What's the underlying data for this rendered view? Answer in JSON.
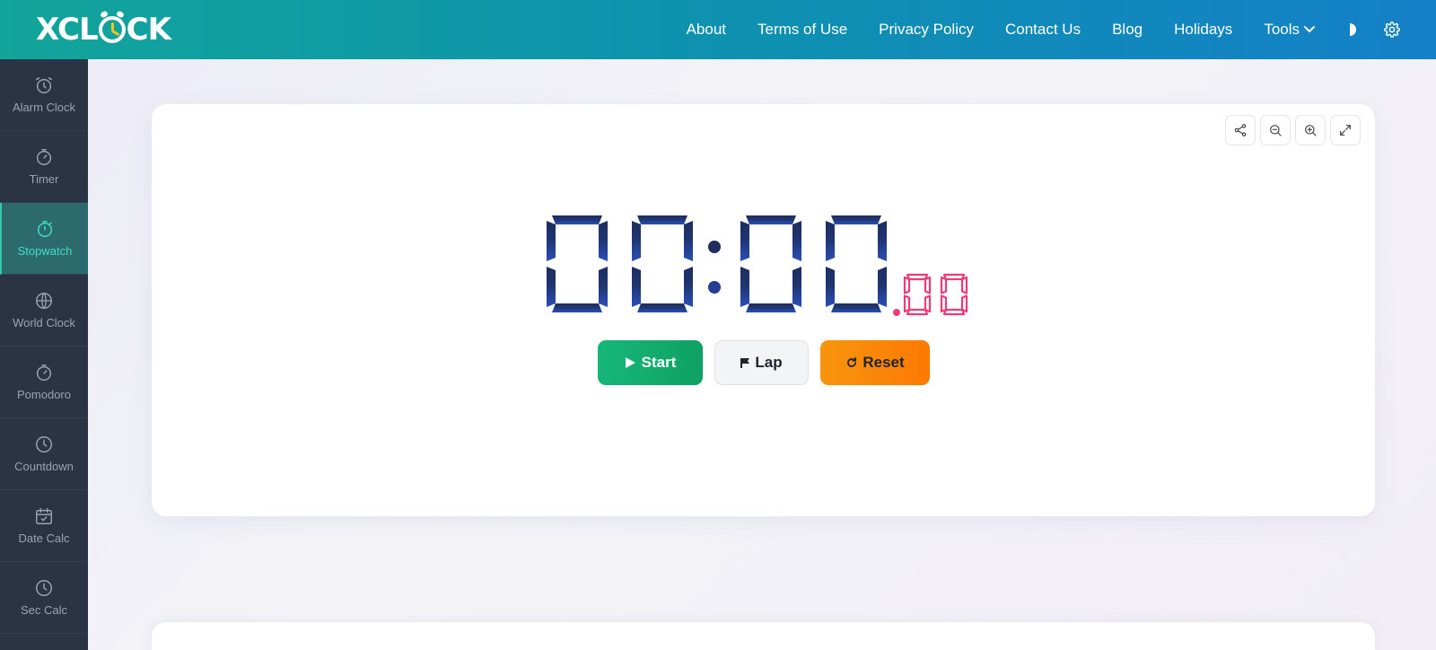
{
  "header": {
    "logo_text": "XCLOCK",
    "nav": {
      "about": "About",
      "terms": "Terms of Use",
      "privacy": "Privacy Policy",
      "contact": "Contact Us",
      "blog": "Blog",
      "holidays": "Holidays",
      "tools": "Tools"
    },
    "icons": [
      "chevron-down-icon",
      "contrast-icon",
      "gear-icon"
    ]
  },
  "sidebar": {
    "items": [
      {
        "label": "Alarm Clock",
        "icon": "alarm-clock-icon"
      },
      {
        "label": "Timer",
        "icon": "timer-icon"
      },
      {
        "label": "Stopwatch",
        "icon": "stopwatch-icon",
        "active": true
      },
      {
        "label": "World Clock",
        "icon": "globe-icon"
      },
      {
        "label": "Pomodoro",
        "icon": "pomodoro-icon"
      },
      {
        "label": "Countdown",
        "icon": "countdown-icon"
      },
      {
        "label": "Date Calc",
        "icon": "calendar-check-icon"
      },
      {
        "label": "Sec Calc",
        "icon": "clock-icon"
      }
    ]
  },
  "stopwatch": {
    "minutes": "00",
    "seconds": "00",
    "hundredths": "00",
    "tools": [
      "share-icon",
      "zoom-out-icon",
      "zoom-in-icon",
      "expand-icon"
    ],
    "buttons": {
      "start": "Start",
      "lap": "Lap",
      "reset": "Reset"
    }
  },
  "colors": {
    "header_start": "#12a59a",
    "header_end": "#1480c8",
    "sidebar_bg": "#2b3444",
    "active_accent": "#3ee0c5",
    "digit_dark": "#1e2d5e",
    "digit_blue": "#2347a6",
    "hundredths": "#ee3b78",
    "start": "#13ad6e",
    "reset": "#fa8708"
  }
}
